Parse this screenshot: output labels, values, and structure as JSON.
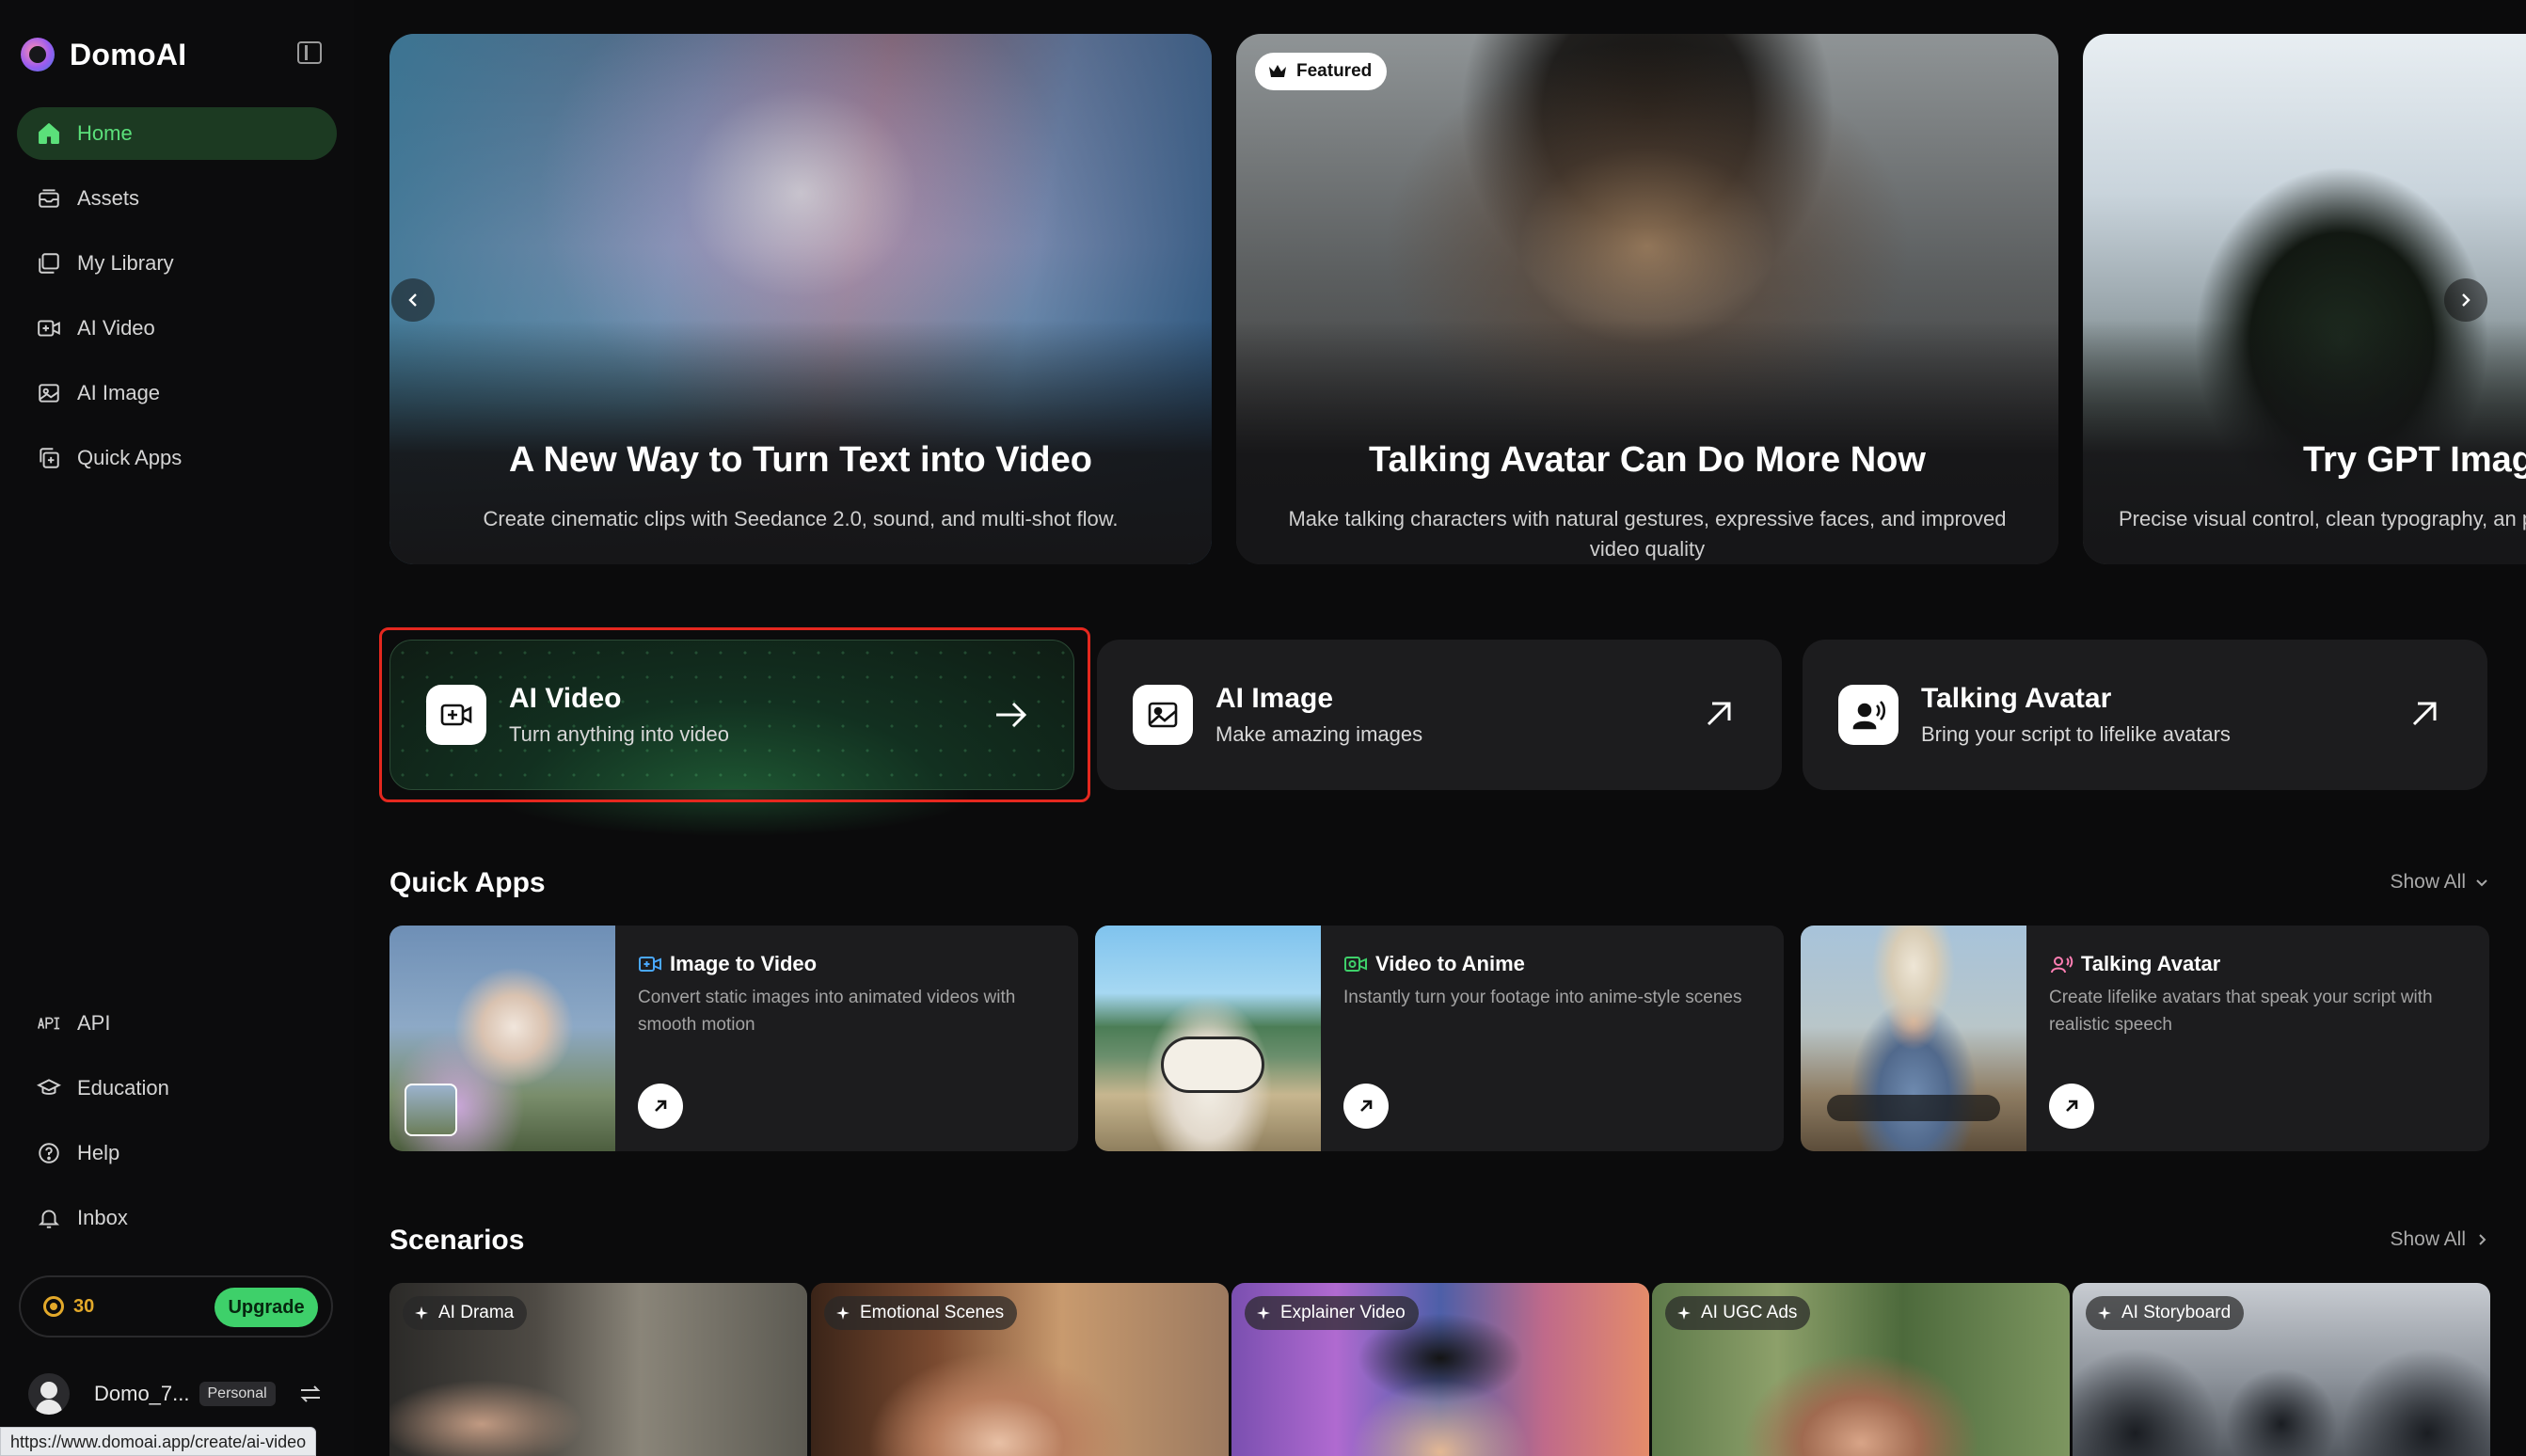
{
  "sidebar": {
    "brand": "DomoAI",
    "nav": [
      {
        "label": "Home",
        "icon": "home-icon"
      },
      {
        "label": "Assets",
        "icon": "assets-icon"
      },
      {
        "label": "My Library",
        "icon": "library-icon"
      },
      {
        "label": "AI Video",
        "icon": "video-icon"
      },
      {
        "label": "AI Image",
        "icon": "image-icon"
      },
      {
        "label": "Quick Apps",
        "icon": "apps-icon"
      }
    ],
    "bottom_nav": [
      {
        "label": "API",
        "icon": "api-icon"
      },
      {
        "label": "Education",
        "icon": "education-icon"
      },
      {
        "label": "Help",
        "icon": "help-icon"
      },
      {
        "label": "Inbox",
        "icon": "bell-icon"
      }
    ],
    "credits": "30",
    "upgrade_label": "Upgrade",
    "username": "Domo_7...",
    "plan": "Personal"
  },
  "status_url": "https://www.domoai.app/create/ai-video",
  "banners": [
    {
      "title": "A New Way to Turn Text into Video",
      "desc": "Create cinematic clips with Seedance 2.0, sound, and multi-shot flow."
    },
    {
      "badge": "Featured",
      "title": "Talking Avatar Can Do More Now",
      "desc": "Make talking characters with natural gestures, expressive faces, and improved video quality"
    },
    {
      "title": "Try GPT Imag",
      "desc": "Precise visual control, clean typography, an part of your w"
    }
  ],
  "features": [
    {
      "title": "AI Video",
      "subtitle": "Turn anything into video"
    },
    {
      "title": "AI Image",
      "subtitle": "Make amazing images"
    },
    {
      "title": "Talking Avatar",
      "subtitle": "Bring your script to lifelike avatars"
    }
  ],
  "quick_apps": {
    "title": "Quick Apps",
    "show_all": "Show All",
    "items": [
      {
        "title": "Image to Video",
        "desc": "Convert static images into animated videos with smooth motion"
      },
      {
        "title": "Video to Anime",
        "desc": "Instantly turn your footage into anime-style scenes"
      },
      {
        "title": "Talking Avatar",
        "desc": "Create lifelike avatars that speak your script with realistic speech"
      }
    ]
  },
  "scenarios": {
    "title": "Scenarios",
    "show_all": "Show All",
    "items": [
      {
        "label": "AI Drama"
      },
      {
        "label": "Emotional Scenes"
      },
      {
        "label": "Explainer Video"
      },
      {
        "label": "AI UGC Ads"
      },
      {
        "label": "AI Storyboard"
      }
    ]
  },
  "colors": {
    "accent": "#3ed06a",
    "active_nav_bg": "#1c3a22",
    "highlight": "#e5281f"
  }
}
